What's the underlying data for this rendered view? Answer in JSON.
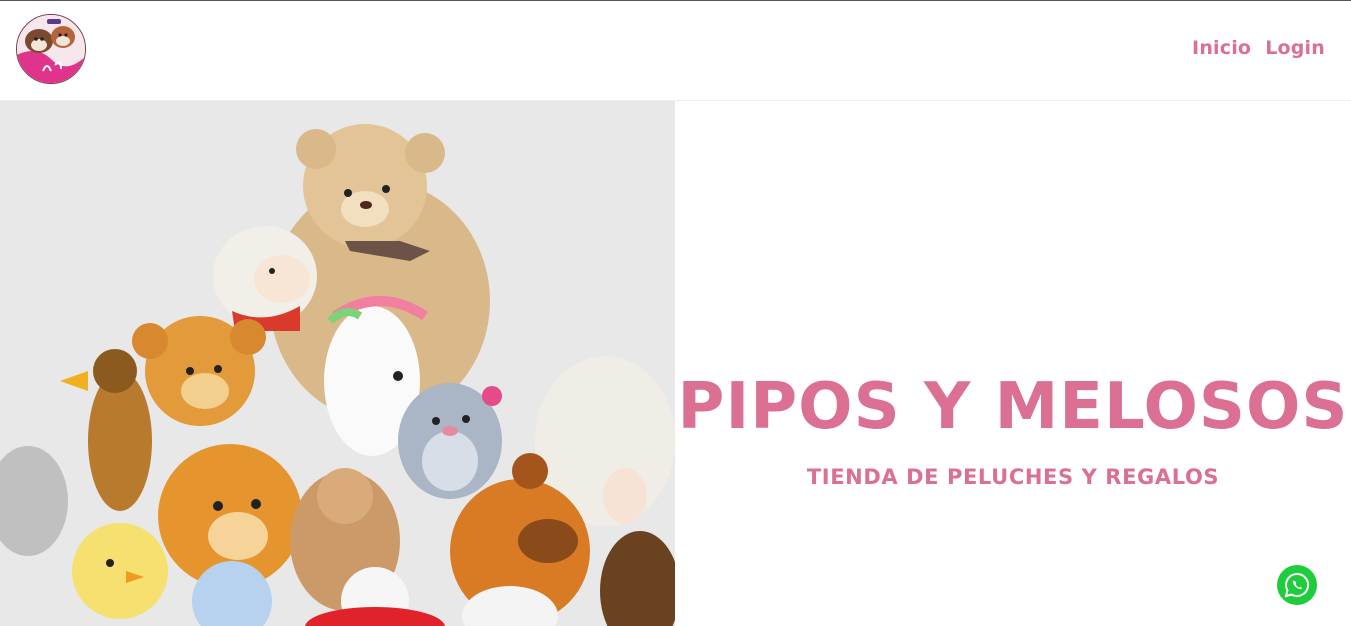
{
  "header": {
    "logo_icon": "brand-logo-icon",
    "nav": [
      {
        "label": "Inicio"
      },
      {
        "label": "Login"
      }
    ]
  },
  "hero": {
    "image_icon": "plush-toys-photo",
    "title": "PIPOS Y MELOSOS",
    "subtitle": "TIENDA DE PELUCHES Y REGALOS"
  },
  "whatsapp": {
    "icon": "whatsapp-icon"
  },
  "colors": {
    "accent": "#db7093",
    "whatsapp": "#1ecc3c",
    "hero_bg": "#e8e8e8"
  }
}
